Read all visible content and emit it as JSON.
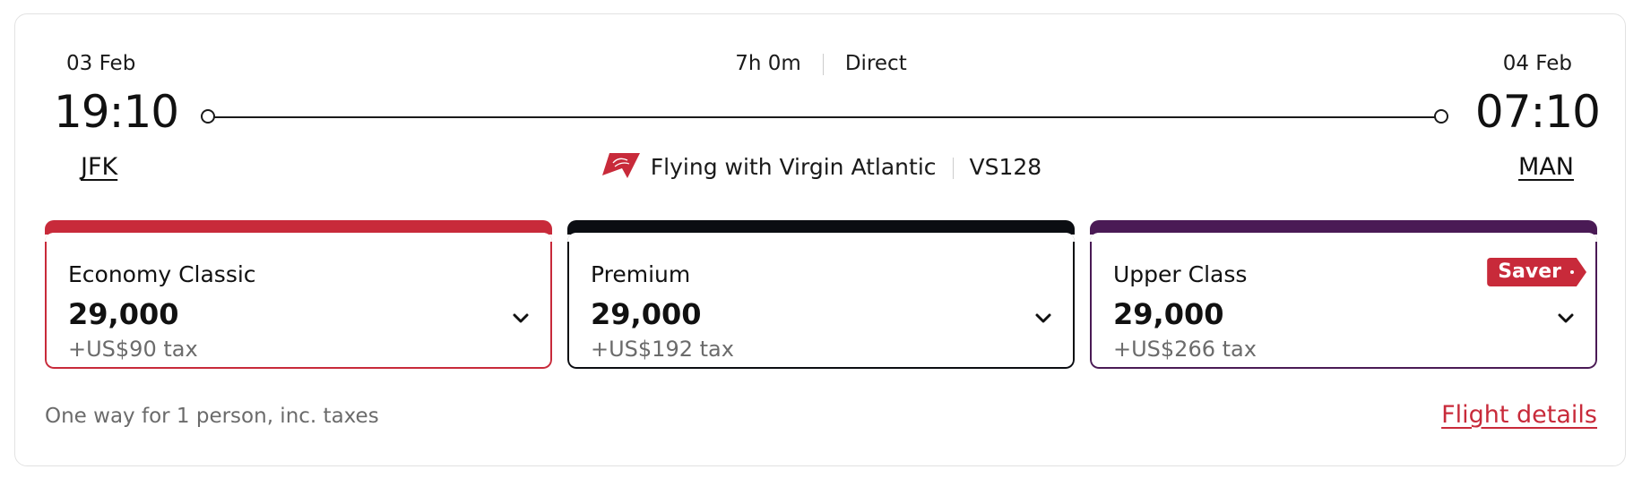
{
  "departure": {
    "date": "03 Feb",
    "time": "19:10",
    "airport": "JFK"
  },
  "arrival": {
    "date": "04 Feb",
    "time": "07:10",
    "airport": "MAN"
  },
  "journey": {
    "duration": "7h 0m",
    "stops": "Direct"
  },
  "airline": {
    "operator": "Flying with Virgin Atlantic",
    "flight_number": "VS128",
    "logo_icon": "virgin-atlantic-logo",
    "logo_color": "#c82a3a"
  },
  "fares": [
    {
      "cabin": "Economy Classic",
      "points": "29,000",
      "tax": "+US$90 tax",
      "color": "#c82a3a"
    },
    {
      "cabin": "Premium",
      "points": "29,000",
      "tax": "+US$192 tax",
      "color": "#0b0d12"
    },
    {
      "cabin": "Upper Class",
      "points": "29,000",
      "tax": "+US$266 tax",
      "color": "#4a1a55",
      "badge": "Saver"
    }
  ],
  "footer": {
    "note": "One way for 1 person, inc. taxes",
    "details_link": "Flight details"
  }
}
